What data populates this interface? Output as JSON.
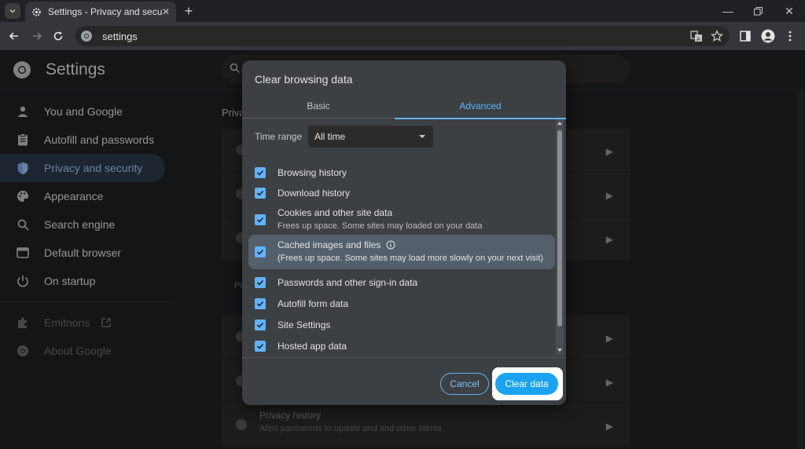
{
  "browser": {
    "tab_title": "Settings - Privacy and security",
    "address": "settings"
  },
  "settings": {
    "title": "Settings",
    "sidebar": [
      {
        "label": "You and Google",
        "icon": "person-icon"
      },
      {
        "label": "Autofill and passwords",
        "icon": "clipboard-icon"
      },
      {
        "label": "Privacy and security",
        "icon": "shield-icon",
        "active": true
      },
      {
        "label": "Appearance",
        "icon": "palette-icon"
      },
      {
        "label": "Search engine",
        "icon": "search-icon"
      },
      {
        "label": "Default browser",
        "icon": "browser-icon"
      },
      {
        "label": "On startup",
        "icon": "power-icon"
      }
    ],
    "sidebar_extra": [
      {
        "label": "Emitnons",
        "icon": "puzzle-icon"
      },
      {
        "label": "About Google",
        "icon": "chrome-icon"
      }
    ],
    "section_label": "Priva",
    "partial_label": "Pr",
    "privacy_history_title": "Privacy history",
    "privacy_history_sub": "Allps passwords to update and and other stents"
  },
  "dialog": {
    "title": "Clear browsing data",
    "tabs": [
      "Basic",
      "Advanced"
    ],
    "active_tab": "Advanced",
    "time_range_label": "Time range",
    "time_range_value": "All time",
    "options": [
      {
        "label": "Browsing history",
        "checked": true
      },
      {
        "label": "Download history",
        "checked": true
      },
      {
        "label": "Cookies and other site data",
        "sub": "Frees up space. Some sites may loaded on your data",
        "checked": true
      },
      {
        "label": "Cached images and files",
        "sub": "(Frees up space. Some sites may load more slowly on your next visit)",
        "checked": true,
        "highlighted": true
      },
      {
        "label": "Passwords and other sign-in data",
        "checked": true
      },
      {
        "label": "Autofill form data",
        "checked": true
      },
      {
        "label": "Site Settings",
        "checked": true
      },
      {
        "label": "Hosted app data",
        "checked": true
      }
    ],
    "cancel_label": "Cancel",
    "clear_label": "Clear data"
  },
  "colors": {
    "accent": "#5fb4ff",
    "clear_button": "#1aa3f0",
    "dialog_bg": "#3c4043"
  }
}
